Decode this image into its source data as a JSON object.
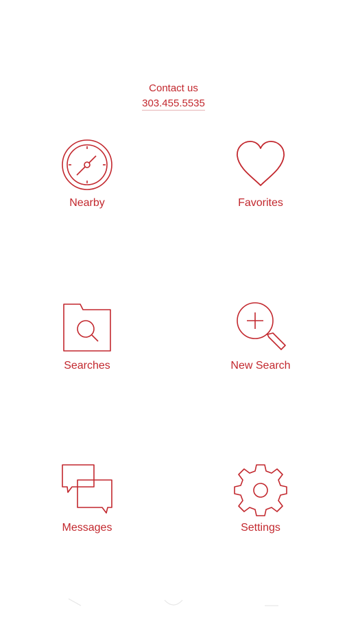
{
  "contact": {
    "label": "Contact us",
    "phone": "303.455.5535"
  },
  "accent_color": "#c2272d",
  "menu": [
    {
      "id": "nearby",
      "label": "Nearby",
      "icon": "compass-icon"
    },
    {
      "id": "favorites",
      "label": "Favorites",
      "icon": "heart-icon"
    },
    {
      "id": "searches",
      "label": "Searches",
      "icon": "search-folder-icon"
    },
    {
      "id": "new-search",
      "label": "New Search",
      "icon": "zoom-plus-icon"
    },
    {
      "id": "messages",
      "label": "Messages",
      "icon": "chat-bubbles-icon"
    },
    {
      "id": "settings",
      "label": "Settings",
      "icon": "gear-icon"
    }
  ]
}
